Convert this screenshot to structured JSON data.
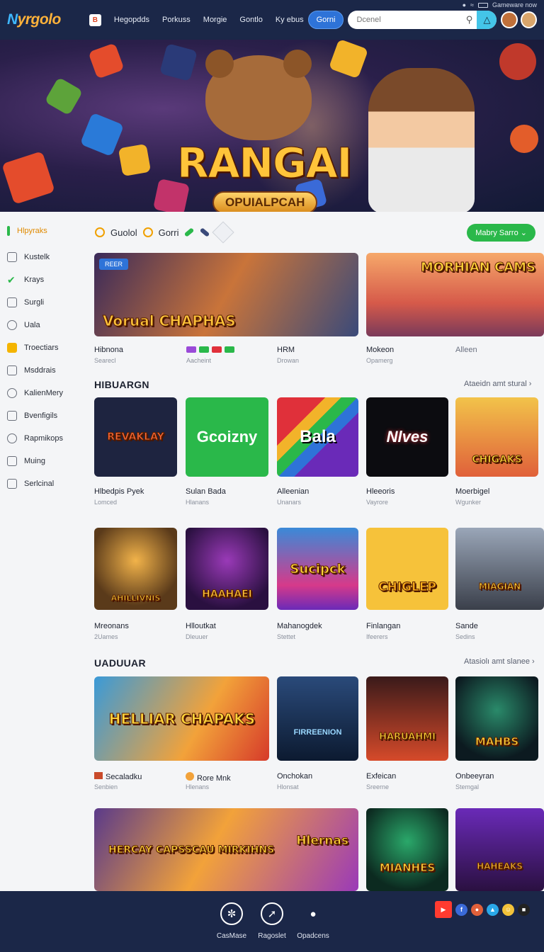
{
  "status": {
    "text": "Gameware now"
  },
  "header": {
    "logo_a": "N",
    "logo_b": "yrgolo",
    "nav_icon": "B",
    "nav": [
      "Hegopdds",
      "Porkuss",
      "Morgie",
      "Gontlo",
      "Ky ebus"
    ],
    "pill": "Gorni",
    "search_placeholder": "Dcenel"
  },
  "hero": {
    "title": "RANGAI",
    "subtitle": "OPUIALPCAH"
  },
  "sidebar": {
    "items": [
      "Hlpyraks",
      "Kustelk",
      "Krays",
      "Surgli",
      "Uala",
      "Troectiars",
      "Msddrais",
      "KalienMery",
      "Bvenfigils",
      "Rapmikops",
      "Muing",
      "Serlcinal"
    ]
  },
  "filters": {
    "chip1": "Guolol",
    "chip2": "Gorri",
    "green_btn": "Mabry Sarro"
  },
  "featured": {
    "badge": "REER",
    "left_art": "Vorual CHAPHAS",
    "right_art": "MORHIAN CAMS",
    "captions": [
      {
        "title": "Hibnona",
        "sub": "Searecl"
      },
      {
        "title": "",
        "sub": "Aacheint"
      },
      {
        "title": "HRM",
        "sub": "Drowan"
      },
      {
        "title": "Mokeon",
        "sub": "Opamerg"
      },
      {
        "title": "Alleen",
        "sub": ""
      }
    ]
  },
  "section1": {
    "title": "HIBUARGN",
    "link": "Ataeidn amt stural",
    "row1": [
      {
        "art": "REVAKLAY",
        "title": "Hlbedpis Pyek",
        "sub": "Lomced"
      },
      {
        "art": "Gcoizny",
        "title": "Sulan Bada",
        "sub": "Hlanans"
      },
      {
        "art": "Bala",
        "title": "Alleenian",
        "sub": "Unanars"
      },
      {
        "art": "Nlves",
        "title": "Hleeoris",
        "sub": "Vayrore"
      },
      {
        "art": "CHIGAKS",
        "title": "Moerbigel",
        "sub": "Wgunker"
      }
    ],
    "row2": [
      {
        "art": "AHILLIVNIS",
        "title": "Mreonans",
        "sub": "2Uames"
      },
      {
        "art": "HAAHAEI",
        "title": "Hlloutkat",
        "sub": "Dleuuer"
      },
      {
        "art": "Sucipck",
        "title": "Mahanogdek",
        "sub": "Stettet"
      },
      {
        "art": "CHIGLEP",
        "title": "Finlangan",
        "sub": "Ifeerers"
      },
      {
        "art": "MIAGIAN",
        "title": "Sande",
        "sub": "Sedins"
      }
    ]
  },
  "section2": {
    "title": "UADUUAR",
    "link": "Atasiolı amt slanee",
    "row1": [
      {
        "art": "HELLIAR CHAPAKS",
        "title": "Secaladku",
        "sub": "Senbien"
      },
      {
        "art": "",
        "title": "Rore Mnk",
        "sub": "Hlenans"
      },
      {
        "art": "FIRREENION",
        "title": "Onchokan",
        "sub": "Hlonsat"
      },
      {
        "art": "HARUAHMI",
        "title": "Exfeican",
        "sub": "Sreerne"
      },
      {
        "art": "MAHBS",
        "title": "Onbeeyran",
        "sub": "Stemgal"
      }
    ],
    "row2": [
      {
        "art": "HERCAY CAPSSCAU MIRKIHNS"
      },
      {
        "art": "Hlernas"
      },
      {
        "art": "MIANHES"
      },
      {
        "art": "HAHEAKS"
      }
    ]
  },
  "bottom": {
    "b1": "CasMase",
    "b2": "Ragoslet",
    "b3": "Opadcens"
  },
  "colors": {
    "header": "#1b2748",
    "accent_green": "#2ab84a",
    "accent_blue": "#2e73d8",
    "accent_orange": "#f0a000"
  },
  "icons": [
    "wifi-icon",
    "battery-icon",
    "search-icon",
    "notification-icon",
    "user-icon",
    "clock-icon",
    "youtube-icon",
    "facebook-icon"
  ]
}
